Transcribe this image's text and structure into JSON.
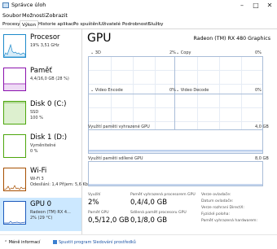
{
  "window": {
    "title": "Správce úloh"
  },
  "menu": [
    "Soubor",
    "Možnosti",
    "Zobrazit"
  ],
  "tabs": [
    "Procesy",
    "Výkon",
    "Historie aplikací",
    "Po spuštění",
    "Uživatelé",
    "Podrobnosti",
    "Služby"
  ],
  "active_tab": "Výkon",
  "sidebar": [
    {
      "name": "Procesor",
      "line1": "19%  3,51 GHz",
      "line2": "",
      "color": "#1e8acb"
    },
    {
      "name": "Paměť",
      "line1": "4,4/16,0 GB (28 %)",
      "line2": "",
      "color": "#8b12ae"
    },
    {
      "name": "Disk 0 (C:)",
      "line1": "SSD",
      "line2": "100 %",
      "color": "#4da60c"
    },
    {
      "name": "Disk 1 (D:)",
      "line1": "Vyměnitelné",
      "line2": "0 %",
      "color": "#4da60c"
    },
    {
      "name": "Wi-Fi",
      "line1": "Wi-Fi 3",
      "line2": "Odesílání: 1,4  Přijem: 5,6 Kb/s",
      "color": "#a74f01"
    },
    {
      "name": "GPU 0",
      "line1": "Radeon (TM) RX 4...",
      "line2": "2% (29 °C)",
      "color": "#1e5bbd"
    }
  ],
  "main": {
    "title": "GPU",
    "model": "Radeon (TM) RX 480 Graphics",
    "engines": [
      {
        "name": "3D",
        "percent": "2%"
      },
      {
        "name": "Copy",
        "percent": "0%"
      },
      {
        "name": "Video Encode",
        "percent": "0%"
      },
      {
        "name": "Video Decode",
        "percent": "0%"
      }
    ],
    "dedicated_label": "Využití paměti vyhrazené GPU",
    "dedicated_max": "4,0 GB",
    "shared_label": "Využití paměti sdílené GPU",
    "shared_max": "8,0 GB",
    "stats": {
      "util_label": "Využití",
      "util_value": "2%",
      "dedicated_label": "Paměť vyhrazená procesorem GPU",
      "dedicated_value": "0,4/4,0 GB",
      "gpu_mem_label": "Paměť GPU",
      "gpu_mem_value": "0,5/12,0 GB",
      "shared_label": "Sdílená paměť procesoru GPU",
      "shared_value": "0,1/8,0 GB"
    },
    "info": {
      "driver_version": "Verze ovladače:",
      "driver_date": "Datum ovladače:",
      "directx": "Verze rozhraní DirectX:",
      "physical_location": "Fyzické poloha:",
      "reserved_memory": "Paměť vyhrazená hardwarem:"
    }
  },
  "bottom": {
    "less_info": "Méně informací",
    "resmon": "Spustit program Sledování prostředků"
  }
}
